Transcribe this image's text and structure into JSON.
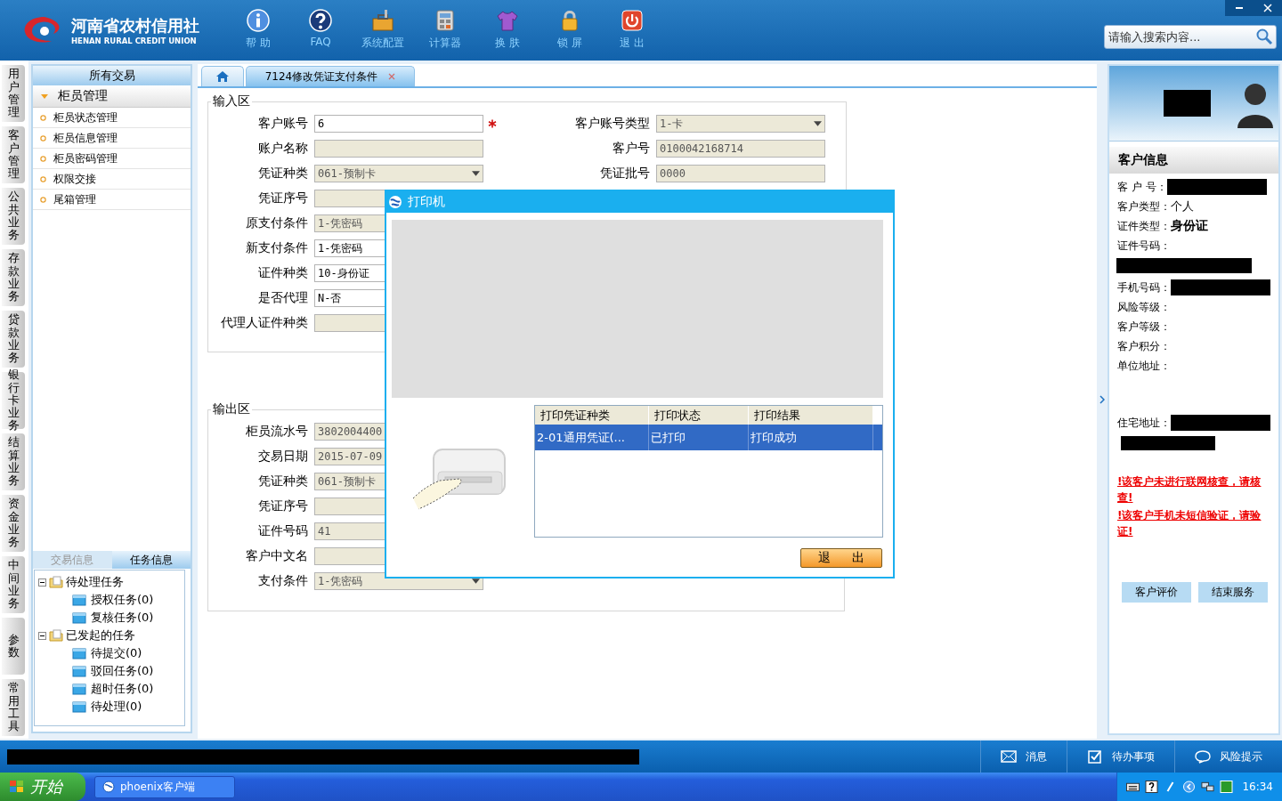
{
  "header": {
    "logo_title": "河南省农村信用社",
    "logo_subtitle": "HENAN RURAL CREDIT UNION",
    "toolbar": [
      {
        "label": "帮 助",
        "kind": "info"
      },
      {
        "label": "FAQ",
        "kind": "faq"
      },
      {
        "label": "系统配置",
        "kind": "tools"
      },
      {
        "label": "计算器",
        "kind": "calculator"
      },
      {
        "label": "换 肤",
        "kind": "skin"
      },
      {
        "label": "锁 屏",
        "kind": "lock"
      },
      {
        "label": "退 出",
        "kind": "exit"
      }
    ],
    "search": {
      "placeholder": "请输入搜索内容..."
    }
  },
  "side_tabs": [
    "用户管理",
    "客户管理",
    "公共业务",
    "存款业务",
    "贷款业务",
    "银行卡业务",
    "结算业务",
    "资金业务",
    "中间业务",
    "参数",
    "常用工具"
  ],
  "sidebar": {
    "title": "所有交易",
    "group": {
      "label": "柜员管理",
      "expanded": true,
      "items": [
        "柜员状态管理",
        "柜员信息管理",
        "柜员密码管理",
        "权限交接",
        "尾箱管理"
      ]
    },
    "bottom_tabs": [
      {
        "label": "交易信息",
        "selected": false
      },
      {
        "label": "任务信息",
        "selected": true
      }
    ],
    "tree": [
      {
        "label": "待处理任务",
        "expanded": true,
        "children": [
          {
            "label": "授权任务(0)"
          },
          {
            "label": "复核任务(0)"
          }
        ]
      },
      {
        "label": "已发起的任务",
        "expanded": true,
        "children": [
          {
            "label": "待提交(0)"
          },
          {
            "label": "驳回任务(0)"
          },
          {
            "label": "超时任务(0)"
          },
          {
            "label": "待处理(0)"
          }
        ]
      }
    ]
  },
  "tabs": [
    {
      "kind": "home",
      "selected": false,
      "closable": false
    },
    {
      "kind": "page",
      "label": "7124修改凭证支付条件",
      "selected": true,
      "closable": true
    }
  ],
  "input_area": {
    "title": "输入区",
    "left": [
      {
        "label": "客户账号",
        "value": "6",
        "editable": true,
        "dropdown": false,
        "required": true
      },
      {
        "label": "账户名称",
        "editable": false,
        "dropdown": false,
        "required": false
      },
      {
        "label": "凭证种类",
        "value": "061-预制卡",
        "editable": false,
        "dropdown": true,
        "required": false
      },
      {
        "label": "凭证序号",
        "editable": false
      },
      {
        "label": "原支付条件",
        "value": "1-凭密码",
        "editable": false
      },
      {
        "label": "新支付条件",
        "value": "1-凭密码",
        "editable": true
      },
      {
        "label": "证件种类",
        "value": "10-身份证",
        "editable": true
      },
      {
        "label": "是否代理",
        "value": "N-否",
        "editable": true
      },
      {
        "label": "代理人证件种类",
        "editable": false
      }
    ],
    "right": [
      {
        "label": "客户账号类型",
        "value": "1-卡",
        "editable": false,
        "dropdown": true,
        "required": false
      },
      {
        "label": "客户号",
        "value": "0100042168714",
        "editable": false,
        "dropdown": false,
        "required": false
      },
      {
        "label": "凭证批号",
        "value": "0000",
        "editable": false,
        "dropdown": false,
        "required": false
      }
    ]
  },
  "output_area": {
    "title": "输出区",
    "left": [
      {
        "label": "柜员流水号",
        "value": "3802004400",
        "editable": false
      },
      {
        "label": "交易日期",
        "value": "2015-07-09",
        "editable": false
      },
      {
        "label": "凭证种类",
        "value": "061-预制卡",
        "editable": false
      },
      {
        "label": "凭证序号",
        "editable": false
      },
      {
        "label": "证件号码",
        "value": "41",
        "editable": false
      },
      {
        "label": "客户中文名",
        "editable": false
      },
      {
        "label": "支付条件",
        "value": "1-凭密码",
        "editable": false,
        "dropdown": true
      }
    ]
  },
  "dialog": {
    "title": "打印机",
    "columns": [
      "打印凭证种类",
      "打印状态",
      "打印结果"
    ],
    "rows": [
      {
        "cells": [
          "2-01通用凭证(...",
          "已打印",
          "打印成功"
        ],
        "selected": true
      }
    ],
    "button": "退 出"
  },
  "customer": {
    "title": "客户信息",
    "fields": [
      {
        "label": "客 户 号：",
        "kind": "redacted"
      },
      {
        "label": "客户类型：",
        "kind": "text",
        "value": "个人"
      },
      {
        "label": "证件类型：",
        "kind": "bold",
        "value": "身份证"
      },
      {
        "label": "证件号码：",
        "kind": "redacted_below"
      },
      {
        "label": "手机号码：",
        "kind": "redacted"
      },
      {
        "label": "风险等级：",
        "kind": "empty"
      },
      {
        "label": "客户等级：",
        "kind": "empty"
      },
      {
        "label": "客户积分：",
        "kind": "empty"
      },
      {
        "label": "单位地址：",
        "kind": "address"
      },
      {
        "label": "住宅地址：",
        "kind": "redacted_two"
      }
    ],
    "warnings": [
      "!该客户未进行联网核查，请核查!",
      "!该客户手机未短信验证，请验证!"
    ],
    "buttons": [
      "客户评价",
      "结束服务"
    ]
  },
  "status_bar": {
    "items": [
      {
        "label": "消息",
        "kind": "message"
      },
      {
        "label": "待办事项",
        "kind": "todo"
      },
      {
        "label": "风险提示",
        "kind": "risk"
      }
    ]
  },
  "taskbar": {
    "start": "开始",
    "tasks": [
      "phoenix客户端"
    ],
    "clock": "16:34"
  }
}
